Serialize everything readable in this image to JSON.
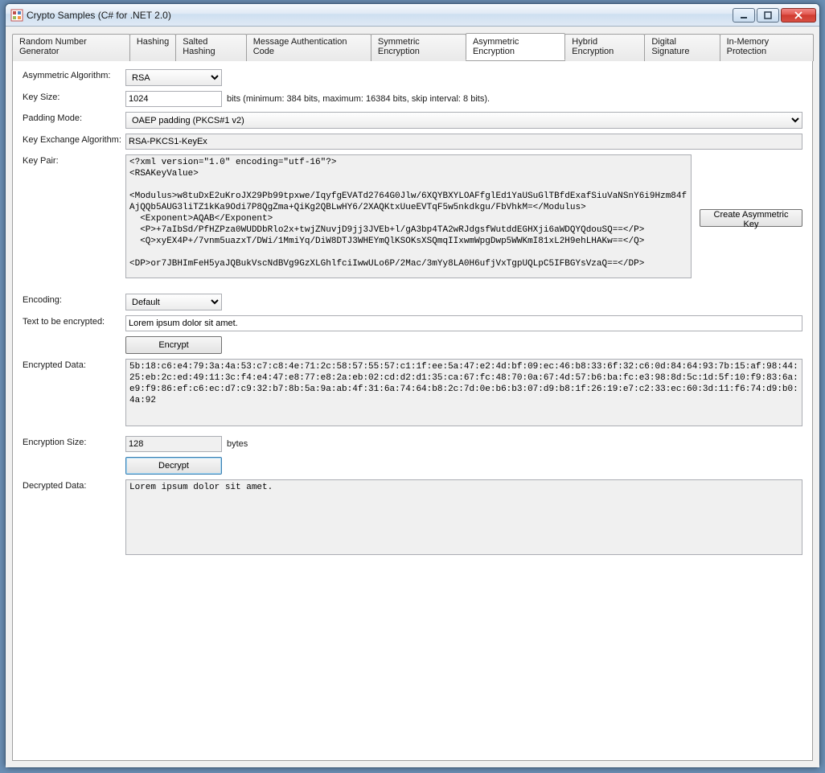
{
  "window": {
    "title": "Crypto Samples (C# for .NET 2.0)",
    "min_tooltip": "Minimize",
    "max_tooltip": "Maximize",
    "close_tooltip": "Close"
  },
  "tabs": [
    {
      "label": "Random Number Generator"
    },
    {
      "label": "Hashing"
    },
    {
      "label": "Salted Hashing"
    },
    {
      "label": "Message Authentication Code"
    },
    {
      "label": "Symmetric Encryption"
    },
    {
      "label": "Asymmetric Encryption"
    },
    {
      "label": "Hybrid Encryption"
    },
    {
      "label": "Digital Signature"
    },
    {
      "label": "In-Memory Protection"
    }
  ],
  "active_tab_index": 5,
  "form": {
    "algorithm": {
      "label": "Asymmetric Algorithm:",
      "value": "RSA"
    },
    "key_size": {
      "label": "Key Size:",
      "value": "1024",
      "hint": "bits (minimum: 384 bits, maximum: 16384 bits, skip interval: 8 bits)."
    },
    "padding_mode": {
      "label": "Padding Mode:",
      "value": "OAEP padding (PKCS#1 v2)"
    },
    "key_exchange": {
      "label": "Key Exchange Algorithm:",
      "value": "RSA-PKCS1-KeyEx"
    },
    "key_pair": {
      "label": "Key Pair:",
      "button": "Create Asymmetric Key",
      "value": "<?xml version=\"1.0\" encoding=\"utf-16\"?>\n<RSAKeyValue>\n\n<Modulus>w8tuDxE2uKroJX29Pb99tpxwe/IqyfgEVATd2764G0Jlw/6XQYBXYLOAFfglEd1YaUSuGlTBfdExafSiuVaNSnY6i9Hzm84fAjQQb5AUG3liTZ1kKa9Odi7P8QgZma+QiKg2QBLwHY6/2XAQKtxUueEVTqF5w5nkdkgu/FbVhkM=</Modulus>\n  <Exponent>AQAB</Exponent>\n  <P>+7aIbSd/PfHZPza0WUDDbRlo2x+twjZNuvjD9jj3JVEb+l/gA3bp4TA2wRJdgsfWutddEGHXji6aWDQYQdouSQ==</P>\n  <Q>xyEX4P+/7vnm5uazxT/DWi/1MmiYq/DiW8DTJ3WHEYmQlKSOKsXSQmqIIxwmWpgDwp5WWKmI81xL2H9ehLHAKw==</Q>\n\n<DP>or7JBHImFeH5yaJQBukVscNdBVg9GzXLGhlfciIwwULo6P/2Mac/3mYy8LA0H6ufjVxTgpUQLpC5IFBGYsVzaQ==</DP>"
    },
    "encoding": {
      "label": "Encoding:",
      "value": "Default"
    },
    "text_to_encrypt": {
      "label": "Text to be encrypted:",
      "value": "Lorem ipsum dolor sit amet."
    },
    "encrypt_button": "Encrypt",
    "encrypted_data": {
      "label": "Encrypted Data:",
      "value": "5b:18:c6:e4:79:3a:4a:53:c7:c8:4e:71:2c:58:57:55:57:c1:1f:ee:5a:47:e2:4d:bf:09:ec:46:b8:33:6f:32:c6:0d:84:64:93:7b:15:af:98:44:25:eb:2c:ed:49:11:3c:f4:e4:47:e8:77:e8:2a:eb:02:cd:d2:d1:35:ca:67:fc:48:70:0a:67:4d:57:b6:ba:fc:e3:98:8d:5c:1d:5f:10:f9:83:6a:e9:f9:86:ef:c6:ec:d7:c9:32:b7:8b:5a:9a:ab:4f:31:6a:74:64:b8:2c:7d:0e:b6:b3:07:d9:b8:1f:26:19:e7:c2:33:ec:60:3d:11:f6:74:d9:b0:4a:92"
    },
    "encryption_size": {
      "label": "Encryption Size:",
      "value": "128",
      "unit": "bytes"
    },
    "decrypt_button": "Decrypt",
    "decrypted_data": {
      "label": "Decrypted Data:",
      "value": "Lorem ipsum dolor sit amet."
    }
  }
}
